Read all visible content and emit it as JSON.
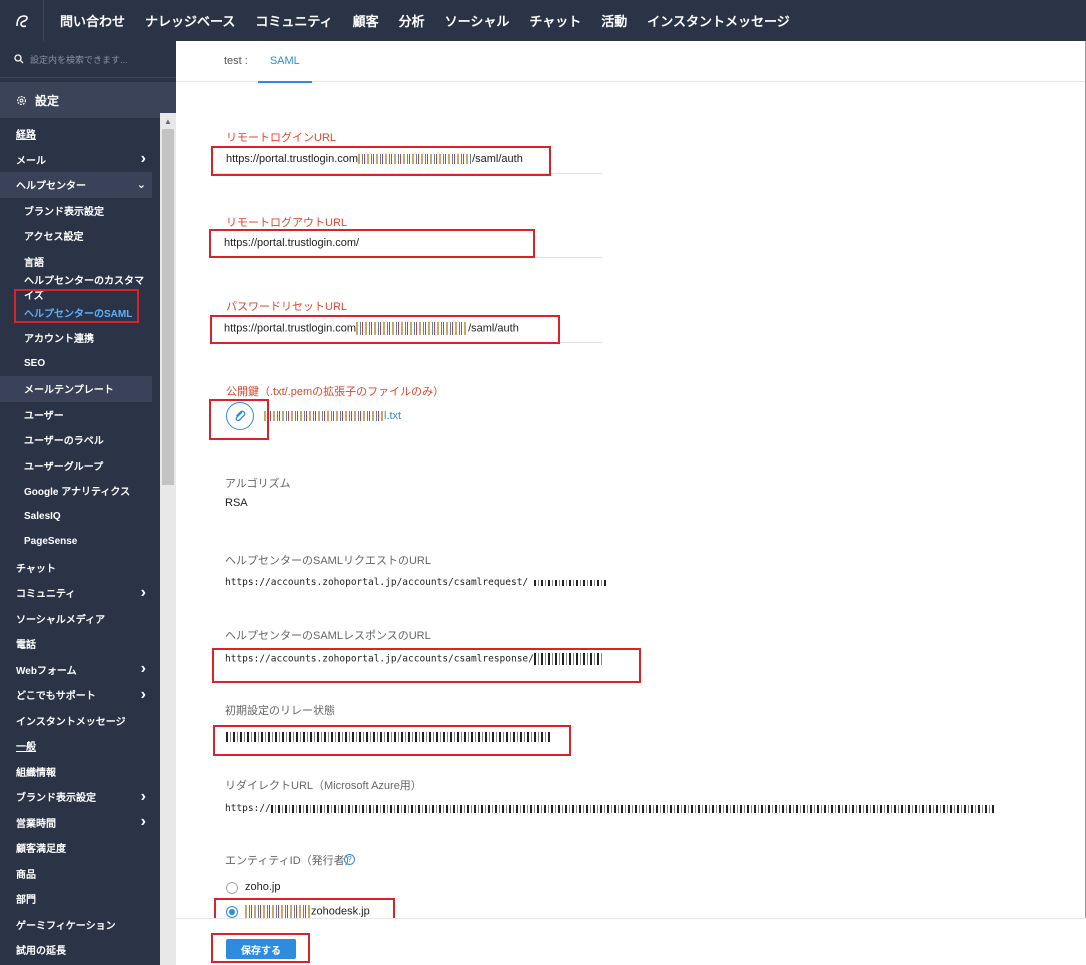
{
  "nav": {
    "items": [
      "問い合わせ",
      "ナレッジベース",
      "コミュニティ",
      "顧客",
      "分析",
      "ソーシャル",
      "チャット",
      "活動",
      "インスタントメッセージ"
    ]
  },
  "sidebar": {
    "search_placeholder": "設定内を検索できます...",
    "settings_label": "設定",
    "items": [
      {
        "label": "経路",
        "type": "section"
      },
      {
        "label": "メール",
        "chevron": "right"
      },
      {
        "label": "ヘルプセンター",
        "chevron": "down",
        "highlight": true
      },
      {
        "label": "ブランド表示設定",
        "sub": true
      },
      {
        "label": "アクセス設定",
        "sub": true
      },
      {
        "label": "言語",
        "sub": true
      },
      {
        "label": "ヘルプセンターのカスタマイズ",
        "sub": true
      },
      {
        "label": "ヘルプセンターのSAML",
        "sub": true,
        "active": true
      },
      {
        "label": "アカウント連携",
        "sub": true
      },
      {
        "label": "SEO",
        "sub": true
      },
      {
        "label": "メールテンプレート",
        "sub": true,
        "highlight": true
      },
      {
        "label": "ユーザー",
        "sub": true
      },
      {
        "label": "ユーザーのラベル",
        "sub": true
      },
      {
        "label": "ユーザーグループ",
        "sub": true
      },
      {
        "label": "Google アナリティクス",
        "sub": true
      },
      {
        "label": "SalesIQ",
        "sub": true
      },
      {
        "label": "PageSense",
        "sub": true
      },
      {
        "label": "チャット"
      },
      {
        "label": "コミュニティ",
        "chevron": "right"
      },
      {
        "label": "ソーシャルメディア"
      },
      {
        "label": "電話"
      },
      {
        "label": "Webフォーム",
        "chevron": "right"
      },
      {
        "label": "どこでもサポート",
        "chevron": "right"
      },
      {
        "label": "インスタントメッセージ"
      },
      {
        "label": "一般",
        "type": "section"
      },
      {
        "label": "組織情報"
      },
      {
        "label": "ブランド表示設定",
        "chevron": "right"
      },
      {
        "label": "営業時間",
        "chevron": "right"
      },
      {
        "label": "顧客満足度"
      },
      {
        "label": "商品"
      },
      {
        "label": "部門"
      },
      {
        "label": "ゲーミフィケーション"
      },
      {
        "label": "試用の延長"
      }
    ]
  },
  "tabs": {
    "prefix": "test :",
    "active": "SAML"
  },
  "form": {
    "login_url_label": "リモートログインURL",
    "login_url_prefix": "https://portal.trustlogin.com",
    "login_url_suffix": "/saml/auth",
    "logout_url_label": "リモートログアウトURL",
    "logout_url_value": "https://portal.trustlogin.com/",
    "pw_reset_label": "パスワードリセットURL",
    "pw_reset_prefix": "https://portal.trustlogin.com",
    "pw_reset_suffix": "/saml/auth",
    "public_key_label": "公開鍵（.txt/.pemの拡張子のファイルのみ）",
    "public_key_file_suffix": "l.txt",
    "algorithm_label": "アルゴリズム",
    "algorithm_value": "RSA",
    "saml_request_label": "ヘルプセンターのSAMLリクエストのURL",
    "saml_request_value": "https://accounts.zohoportal.jp/accounts/csamlrequest/",
    "saml_response_label": "ヘルプセンターのSAMLレスポンスのURL",
    "saml_response_value": "https://accounts.zohoportal.jp/accounts/csamlresponse/",
    "relay_label": "初期設定のリレー状態",
    "redirect_label": "リダイレクトURL（Microsoft Azure用）",
    "redirect_prefix": "https://",
    "entity_label": "エンティティID（発行者）",
    "entity_opt1": "zoho.jp",
    "entity_opt2_suffix": "zohodesk.jp",
    "save_label": "保存する"
  },
  "colors": {
    "nav_bg": "#2b3447",
    "accent": "#2d8ce0",
    "required_label": "#e0442c",
    "annotation_box": "#d8232a"
  }
}
